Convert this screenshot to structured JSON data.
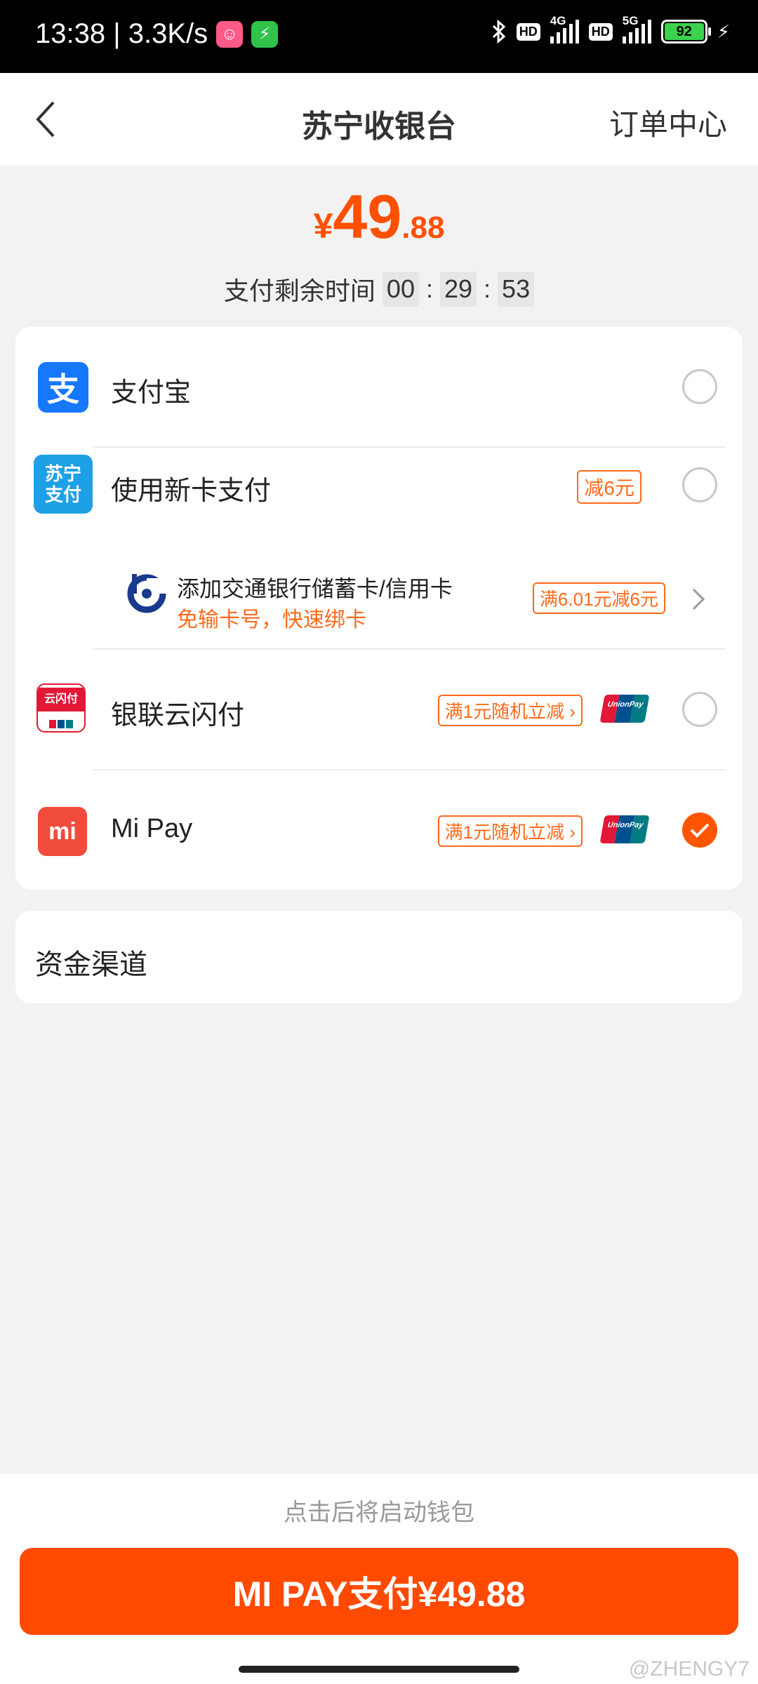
{
  "status_bar": {
    "time_speed": "13:38 | 3.3K/s",
    "hd": "HD",
    "net1": "4G",
    "net2": "5G",
    "battery": "92"
  },
  "header": {
    "title": "苏宁收银台",
    "order_center": "订单中心"
  },
  "amount": {
    "currency": "¥",
    "integer": "49",
    "decimal": ".88"
  },
  "timer": {
    "label": "支付剩余时间",
    "hh": "00",
    "mm": "29",
    "ss": "53",
    "sep": ":"
  },
  "payment_methods": [
    {
      "label": "支付宝",
      "icon_text": "支"
    },
    {
      "label": "使用新卡支付",
      "icon_text": "苏宁支付",
      "tag": "减6元"
    },
    {
      "label": "银联云闪付",
      "icon_text": "云闪付",
      "tag": "满1元随机立减"
    },
    {
      "label": "Mi Pay",
      "icon_text": "mi",
      "tag": "满1元随机立减",
      "selected": true
    }
  ],
  "bank_offer": {
    "line1": "添加交通银行储蓄卡/信用卡",
    "line2": "免输卡号，快速绑卡",
    "tag": "满6.01元减6元"
  },
  "fund_channel": {
    "label": "资金渠道"
  },
  "bottom": {
    "hint": "点击后将启动钱包",
    "pay_button": "MI PAY支付¥49.88",
    "watermark": "@ZHENGY7"
  },
  "colors": {
    "accent": "#ff5000",
    "alipay": "#1677ff",
    "suning_pay": "#1ea0e6",
    "unionpay_red": "#e21836",
    "xiaomi": "#f04b3c"
  }
}
